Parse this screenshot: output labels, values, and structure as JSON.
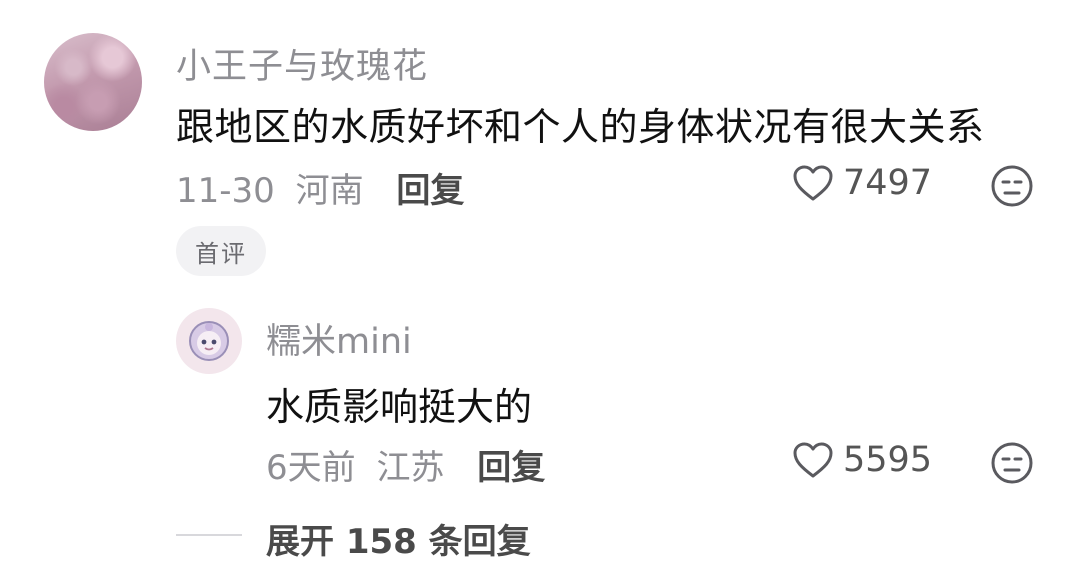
{
  "main_comment": {
    "username": "小王子与玫瑰花",
    "text": "跟地区的水质好坏和个人的身体状况有很大关系",
    "date": "11-30",
    "location": "河南",
    "reply_label": "回复",
    "likes": "7497",
    "tag": "首评",
    "icons": [
      "heart-icon",
      "dislike-emoji-icon"
    ]
  },
  "reply_comment": {
    "username": "糯米mini",
    "text": "水质影响挺大的",
    "date": "6天前",
    "location": "江苏",
    "reply_label": "回复",
    "likes": "5595",
    "icons": [
      "heart-icon",
      "dislike-emoji-icon"
    ]
  },
  "expand": {
    "label": "展开 158 条回复"
  }
}
